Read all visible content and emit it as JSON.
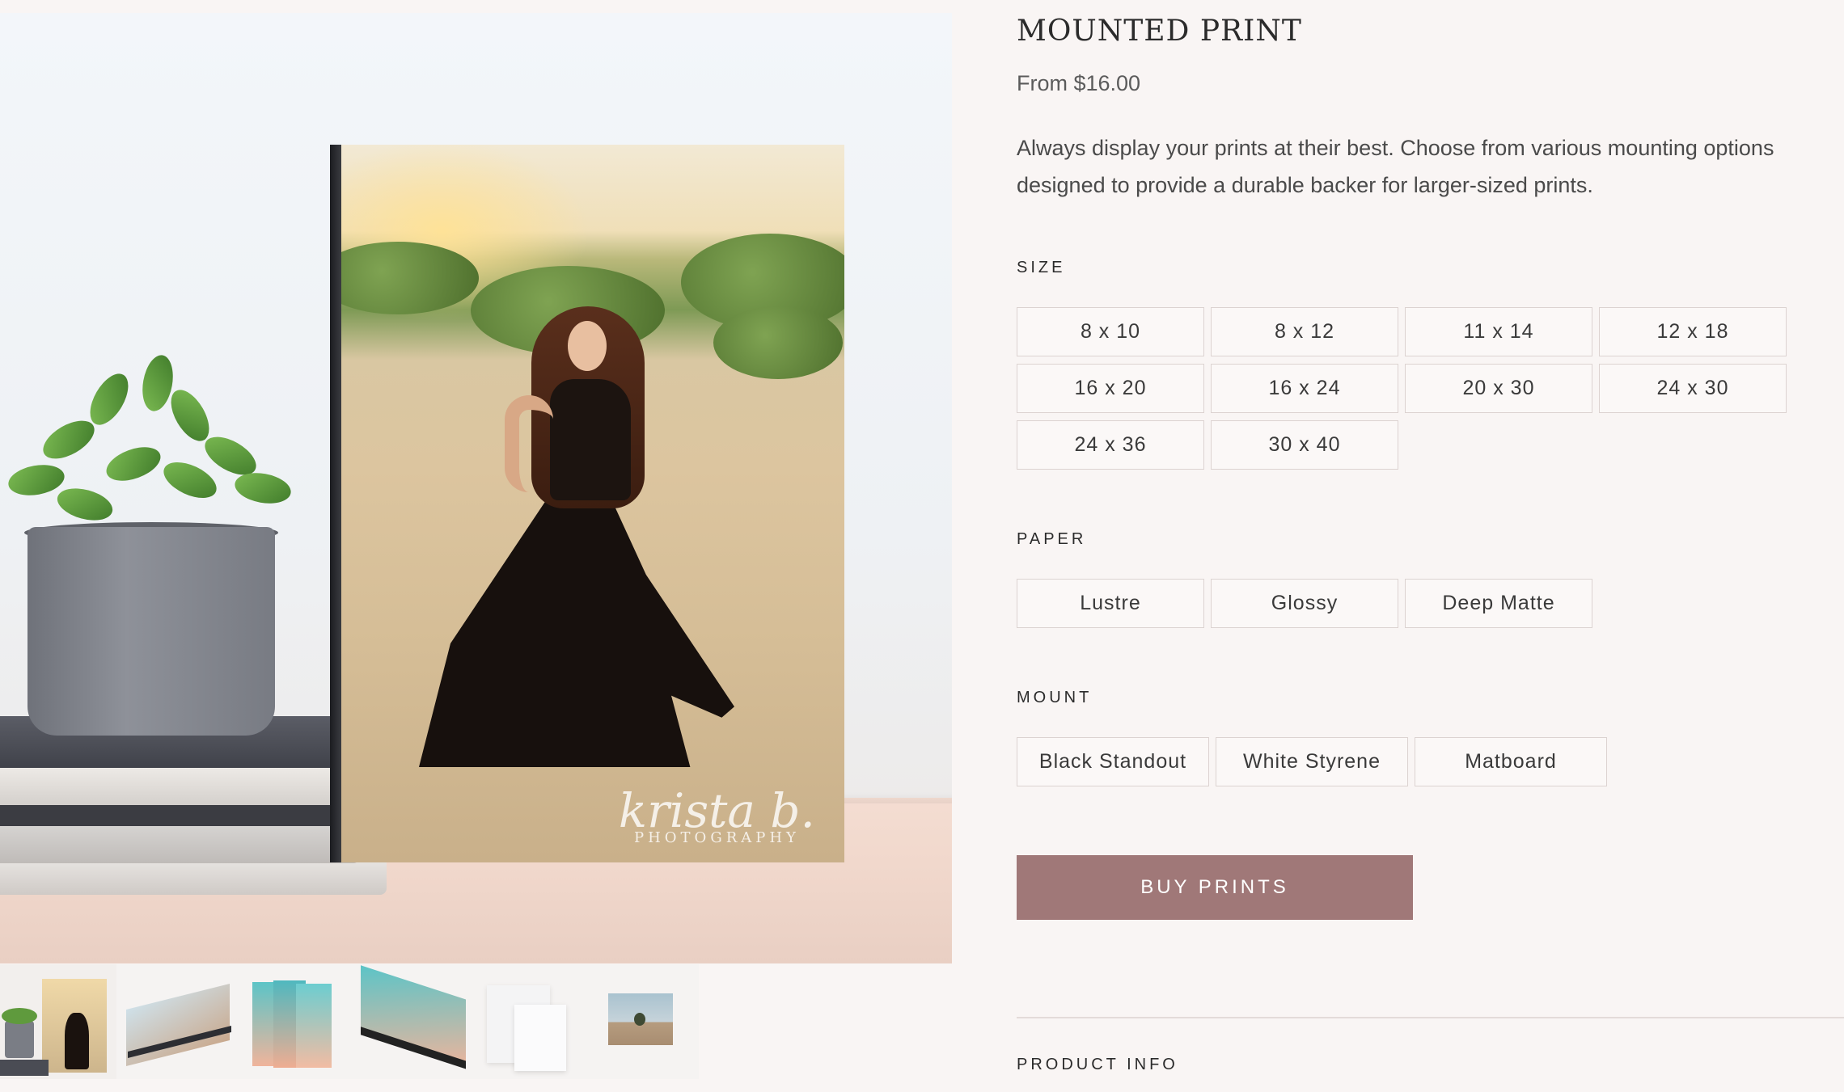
{
  "product": {
    "title": "MOUNTED PRINT",
    "price": "From $16.00",
    "description": "Always display your prints at their best. Choose from various mounting options designed to provide a durable backer for larger-sized prints."
  },
  "options": {
    "size": {
      "label": "SIZE",
      "values": [
        "8 x 10",
        "8 x 12",
        "11 x 14",
        "12 x 18",
        "16 x 20",
        "16 x 24",
        "20 x 30",
        "24 x 30",
        "24 x 36",
        "30 x 40"
      ]
    },
    "paper": {
      "label": "PAPER",
      "values": [
        "Lustre",
        "Glossy",
        "Deep Matte"
      ]
    },
    "mount": {
      "label": "MOUNT",
      "values": [
        "Black Standout",
        "White Styrene",
        "Matboard"
      ]
    }
  },
  "buy_button": "BUY PRINTS",
  "product_info_label": "PRODUCT INFO",
  "watermark": {
    "line1": "krista b.",
    "line2": "PHOTOGRAPHY"
  },
  "gallery": {
    "thumbnail_count": 6,
    "active_thumbnail": 0
  },
  "colors": {
    "background": "#f9f5f4",
    "buy_button": "#a07878",
    "option_border": "#dcd3d1"
  }
}
